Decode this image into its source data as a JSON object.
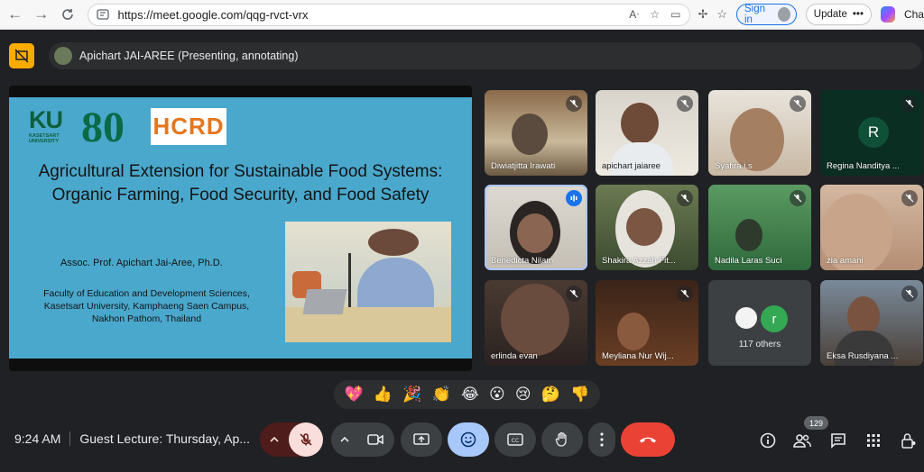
{
  "browser": {
    "url": "https://meet.google.com/qqg-rvct-vrx",
    "signin_label": "Sign in",
    "update_label": "Update",
    "copilot_label": "Cha"
  },
  "presenter": {
    "label": "Apichart JAI-AREE (Presenting, annotating)"
  },
  "slide": {
    "ku_logo": "KU",
    "ku_sub": "KASETSART UNIVERSITY",
    "anniv": "80",
    "hcrd_logo": "HCRD",
    "title_line1": "Agricultural Extension for Sustainable Food Systems:",
    "title_line2": "Organic Farming, Food Security, and Food Safety",
    "author": "Assoc. Prof. Apichart Jai-Aree, Ph.D.",
    "affil_line1": "Faculty of Education and Development Sciences,",
    "affil_line2": "Kasetsart University, Kamphaeng Saen Campus,",
    "affil_line3": "Nakhon Pathom, Thailand"
  },
  "participants": [
    {
      "name": "Diwiatjitta Irawati",
      "muted": true
    },
    {
      "name": "apichart jaiaree",
      "muted": true
    },
    {
      "name": "Syafira i.s",
      "muted": true
    },
    {
      "name": "Regina Nanditya ...",
      "muted": true,
      "initial": "R"
    },
    {
      "name": "Benedicta Nilam",
      "muted": false,
      "speaking": true
    },
    {
      "name": "Shakira Azzah Fit...",
      "muted": true
    },
    {
      "name": "Nadila Laras Suci",
      "muted": true
    },
    {
      "name": "zia amani",
      "muted": true
    },
    {
      "name": "erlinda evan",
      "muted": true
    },
    {
      "name": "Meyliana Nur Wij...",
      "muted": true
    },
    {
      "name": "Eksa Rusdiyana ...",
      "muted": true
    }
  ],
  "others": {
    "count_label": "117 others",
    "initial": "r"
  },
  "reactions": [
    "💖",
    "👍",
    "🎉",
    "👏",
    "😂",
    "😮",
    "😢",
    "🤔",
    "👎"
  ],
  "bottom": {
    "time": "9:24 AM",
    "meeting_title": "Guest Lecture: Thursday, Ap...",
    "people_count": "129"
  },
  "colors": {
    "meet_bg": "#202124",
    "slide_bg": "#4aa8cc",
    "end_call": "#ea4335",
    "mic_off": "#f9dedc",
    "accent_blue": "#1a73e8",
    "presenting_badge": "#f9ab00"
  }
}
